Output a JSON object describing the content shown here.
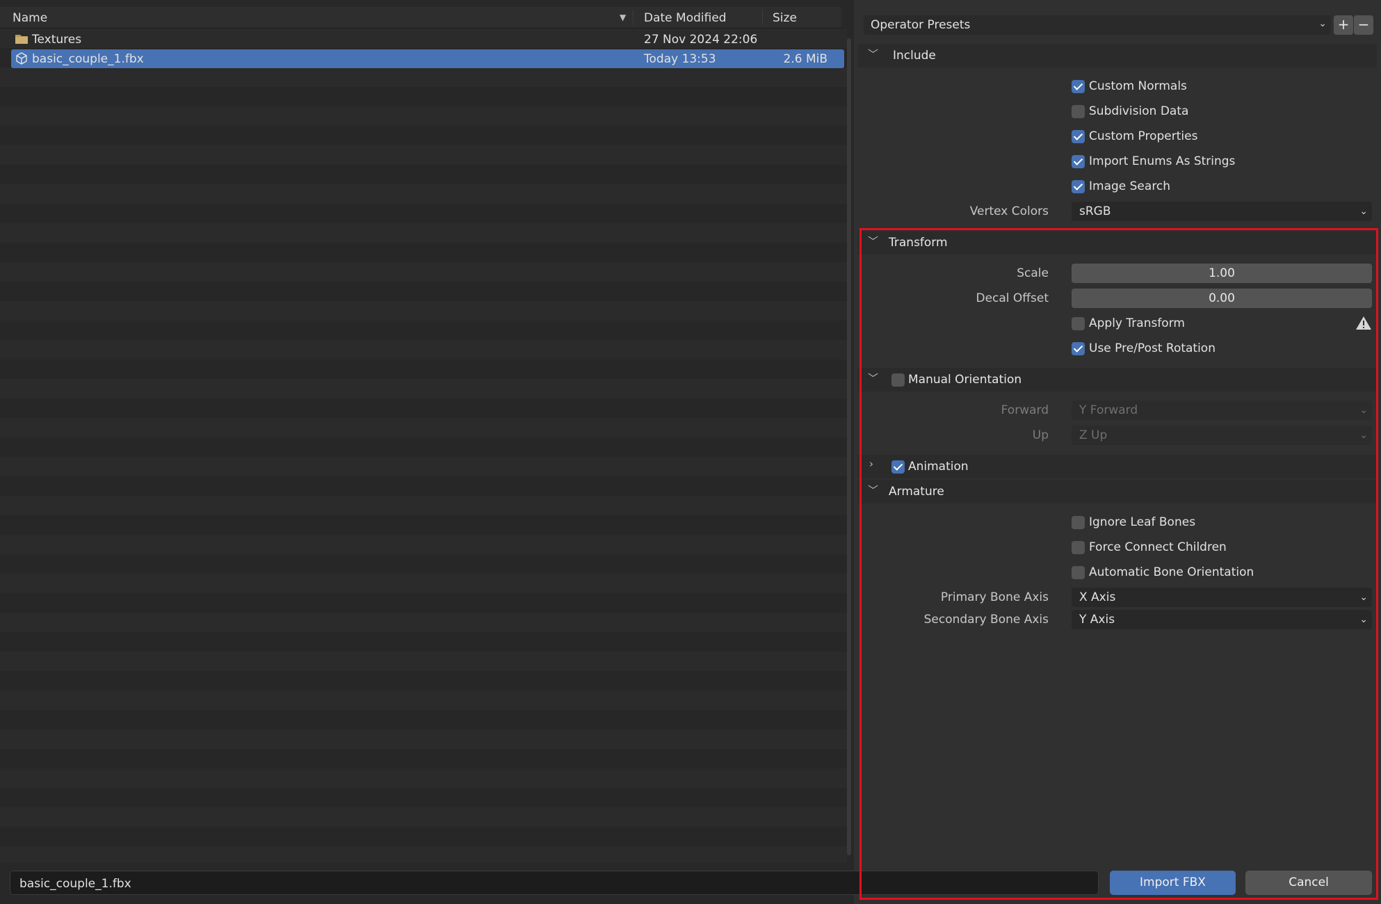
{
  "file_browser": {
    "columns": {
      "name": "Name",
      "date": "Date Modified",
      "size": "Size"
    },
    "files": [
      {
        "name": "Textures",
        "date": "27 Nov 2024 22:06",
        "size": "",
        "icon": "folder-icon",
        "selected": false
      },
      {
        "name": "basic_couple_1.fbx",
        "date": "Today 13:53",
        "size": "2.6 MiB",
        "icon": "mesh-file-icon",
        "selected": true
      }
    ]
  },
  "presets": {
    "label": "Operator Presets",
    "add": "+",
    "remove": "−"
  },
  "include": {
    "title": "Include",
    "custom_normals": "Custom Normals",
    "subdivision_data": "Subdivision Data",
    "custom_properties": "Custom Properties",
    "import_enums": "Import Enums As Strings",
    "image_search": "Image Search",
    "vertex_colors_label": "Vertex Colors",
    "vertex_colors_value": "sRGB",
    "checked": {
      "custom_normals": true,
      "subdivision_data": false,
      "custom_properties": true,
      "import_enums": true,
      "image_search": true
    }
  },
  "transform": {
    "title": "Transform",
    "scale_label": "Scale",
    "scale_value": "1.00",
    "decal_label": "Decal Offset",
    "decal_value": "0.00",
    "apply_transform": "Apply Transform",
    "use_pre_post": "Use Pre/Post Rotation",
    "checked": {
      "apply_transform": false,
      "use_pre_post": true
    }
  },
  "manual_orientation": {
    "title": "Manual Orientation",
    "enabled": false,
    "forward_label": "Forward",
    "forward_value": "Y Forward",
    "up_label": "Up",
    "up_value": "Z Up"
  },
  "animation": {
    "title": "Animation",
    "enabled": true,
    "expanded": false
  },
  "armature": {
    "title": "Armature",
    "ignore_leaf": "Ignore Leaf Bones",
    "force_connect": "Force Connect Children",
    "auto_orient": "Automatic Bone Orientation",
    "primary_label": "Primary Bone Axis",
    "primary_value": "X Axis",
    "secondary_label": "Secondary Bone Axis",
    "secondary_value": "Y Axis",
    "checked": {
      "ignore_leaf": false,
      "force_connect": false,
      "auto_orient": false
    }
  },
  "bottom": {
    "filename": "basic_couple_1.fbx",
    "import_label": "Import FBX",
    "cancel_label": "Cancel"
  },
  "colors": {
    "accent": "#4772b3",
    "highlight_box": "#e0121d",
    "background": "#303030"
  }
}
